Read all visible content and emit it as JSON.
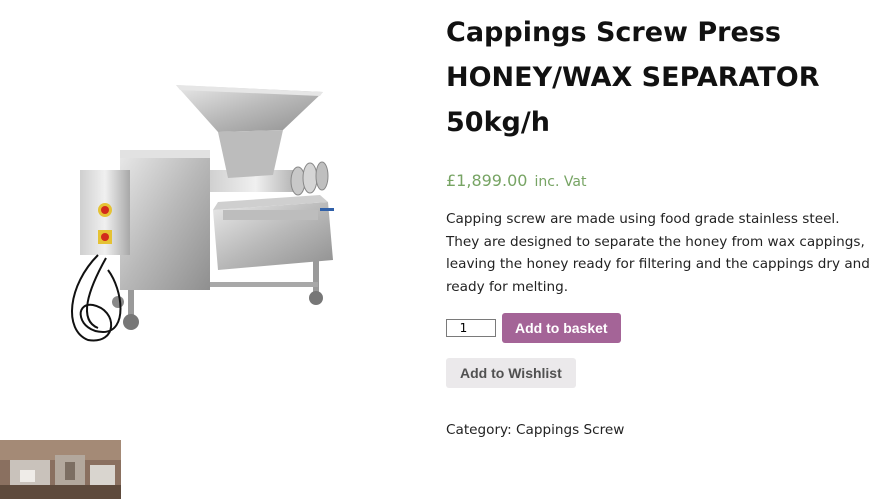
{
  "product": {
    "title_lines": [
      "Cappings Screw Press",
      "HONEY/WAX SEPARATOR",
      "50kg/h"
    ],
    "price": {
      "amount": "£1,899.00",
      "suffix": "inc. Vat",
      "color": "#77a464"
    },
    "description": "Capping screw are made using food grade stainless steel. They are designed to separate the honey from wax cappings, leaving the honey ready for filtering and the cappings dry and ready for melting.",
    "quantity": "1",
    "add_to_basket_label": "Add to basket",
    "add_to_wishlist_label": "Add to Wishlist",
    "category_label": "Category:",
    "category_value": "Cappings Screw"
  },
  "colors": {
    "basket_button": "#a46497",
    "wishlist_button": "#ebe9eb"
  },
  "gallery": {
    "main_image_icon": "cappings-screw-press-photo",
    "thumbnail_icon": "workshop-photo-thumbnail"
  }
}
